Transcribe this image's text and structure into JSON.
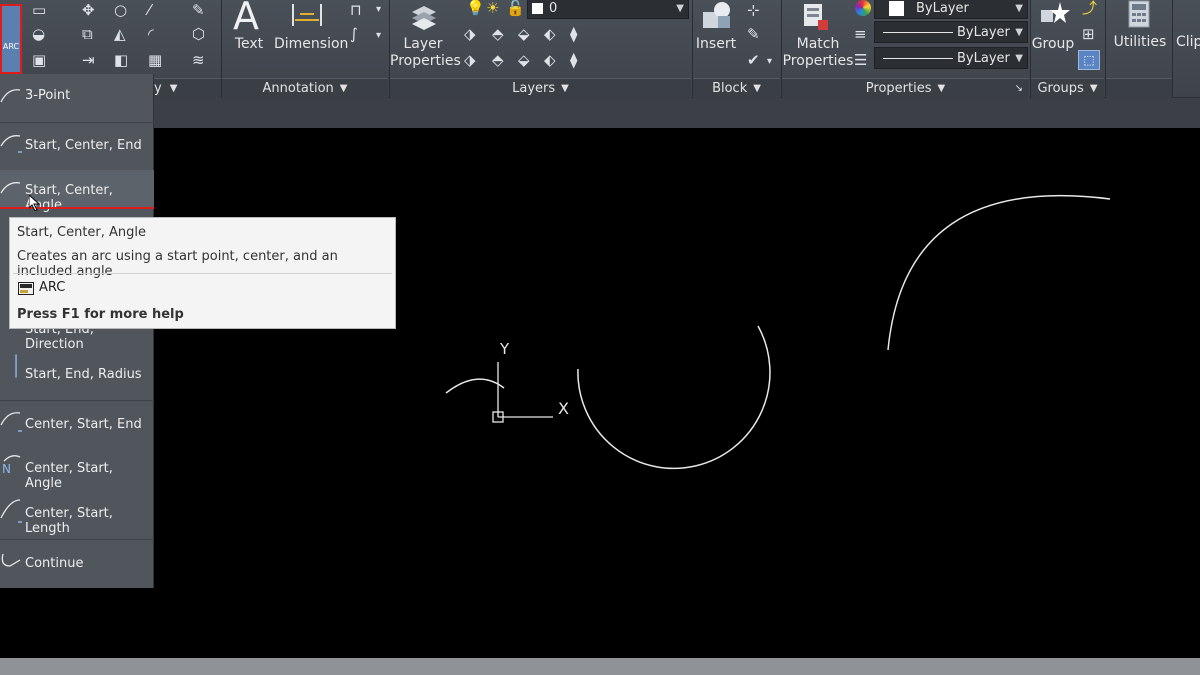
{
  "ribbon": {
    "tools": {
      "text_label": "Text",
      "dimension_label": "Dimension",
      "layer_properties_label_line1": "Layer",
      "layer_properties_label_line2": "Properties",
      "insert_label": "Insert",
      "match_properties_label_line1": "Match",
      "match_properties_label_line2": "Properties",
      "group_label": "Group",
      "utilities_label": "Utilities",
      "clipboard_label": "Clip"
    },
    "panels": {
      "draw_tail": "y",
      "annotation": "Annotation",
      "layers": "Layers",
      "block": "Block",
      "properties": "Properties",
      "groups": "Groups"
    },
    "combos": {
      "layer_value": "0",
      "color_value": "ByLayer",
      "linetype_value": "ByLayer",
      "lineweight_value": "ByLayer"
    },
    "arc_button_label": "ARC"
  },
  "arc_menu": {
    "items": [
      {
        "label": "3-Point"
      },
      {
        "label": "Start, Center, End"
      },
      {
        "label": "Start, Center, Angle"
      },
      {
        "label": "Start, End, Direction"
      },
      {
        "label": "Start, End, Radius"
      },
      {
        "label": "Center, Start, End"
      },
      {
        "label": "Center, Start, Angle"
      },
      {
        "label": "Center, Start, Length"
      },
      {
        "label": "Continue"
      }
    ]
  },
  "tooltip": {
    "title": "Start, Center, Angle",
    "description": "Creates an arc using a start point, center, and an included angle",
    "command": "ARC",
    "help": "Press F1 for more help"
  },
  "ucs": {
    "x_label": "X",
    "y_label": "Y"
  },
  "colors": {
    "ribbon": "#43484f",
    "menu": "#51565d",
    "highlight_red": "#e01b1b",
    "canvas": "#000000",
    "tooltip_bg": "#f4f4f4"
  }
}
